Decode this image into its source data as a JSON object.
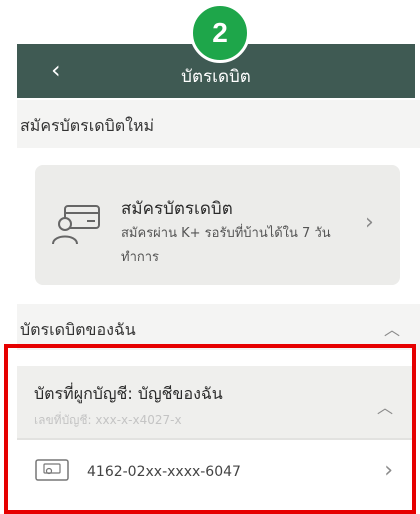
{
  "step_badge": "2",
  "header": {
    "title": "บัตรเดบิต",
    "back_icon": "chevron-left-icon"
  },
  "new_card_section": {
    "label": "สมัครบัตรเดบิตใหม่"
  },
  "apply_card": {
    "title": "สมัครบัตรเดบิต",
    "description": "สมัครผ่าน K+ รอรับที่บ้านได้ใน 7 วันทำการ",
    "icon": "person-card-icon"
  },
  "my_cards_section": {
    "label": "บัตรเดบิตของฉัน",
    "expanded": true
  },
  "linked_account": {
    "title": "บัตรที่ผูกบัญชี: บัญชีของฉัน",
    "account_label": "เลขที่บัญชี: xxx-x-x4027-x",
    "expanded": true
  },
  "card_item": {
    "number": "4162-02xx-xxxx-6047",
    "icon": "card-icon"
  },
  "colors": {
    "header": "#3f5a53",
    "badge": "#1ea64a",
    "highlight": "#e60000"
  }
}
